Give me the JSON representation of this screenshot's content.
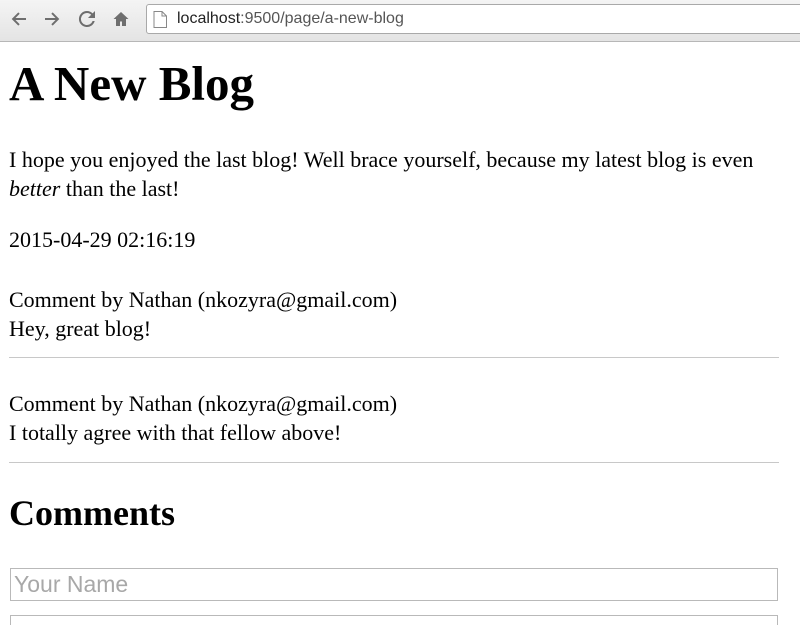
{
  "browser": {
    "url_host": "localhost",
    "url_rest": ":9500/page/a-new-blog"
  },
  "post": {
    "title": "A New Blog",
    "body_before": "I hope you enjoyed the last blog! Well brace yourself, because my latest blog is even ",
    "body_emphasis": "better",
    "body_after": " than the last!",
    "timestamp": "2015-04-29 02:16:19"
  },
  "comments": [
    {
      "byline": "Comment by Nathan (nkozyra@gmail.com)",
      "text": "Hey, great blog!"
    },
    {
      "byline": "Comment by Nathan (nkozyra@gmail.com)",
      "text": "I totally agree with that fellow above!"
    }
  ],
  "comment_form": {
    "heading": "Comments",
    "name_placeholder": "Your Name"
  }
}
